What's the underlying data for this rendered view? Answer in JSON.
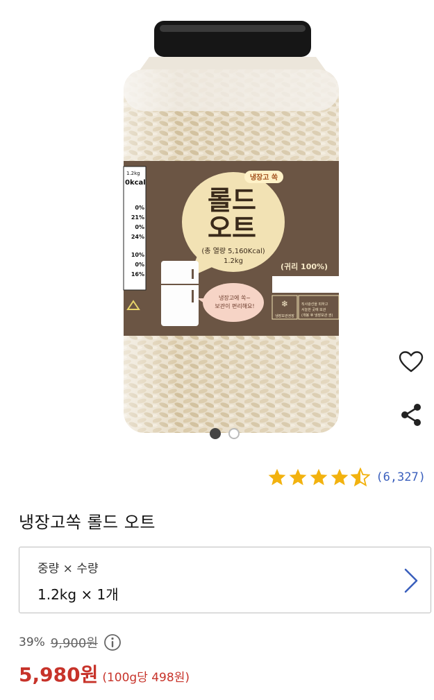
{
  "product": {
    "image": {
      "lid_label": "",
      "badge_small": "냉장고 쏙",
      "brand_line1": "롤드",
      "brand_line2": "오트",
      "calorie_line": "(총 열량 5,160Kcal)",
      "weight_line": "1.2kg",
      "ingredient": "(귀리 100%)",
      "bubble": "냉장고에 쏙~ 보관이 편리해요!",
      "nutrition_header": "1.2kg",
      "nutrition_kcal": "0kcal",
      "nutrition_pcts": [
        "0%",
        "21%",
        "0%",
        "24%",
        "10%",
        "0%",
        "16%"
      ],
      "storage_label": "냉장보관권장",
      "storage_text": "직사광선을 피하고 서늘한 곳에 보관 (개봉 후 냉장보관 권)"
    },
    "carousel": {
      "count": 2,
      "active": 1
    },
    "actions": {
      "favorite_icon": "heart-outline-icon",
      "share_icon": "share-icon"
    },
    "rating": {
      "stars": 4.5,
      "count_text": "(6,327)"
    },
    "title": "냉장고쏙 롤드 오트",
    "option": {
      "label": "중량 × 수량",
      "value": "1.2kg × 1개"
    },
    "price": {
      "discount": "39%",
      "original": "9,900원",
      "sale": "5,980원",
      "unit": "(100g당 498원)"
    },
    "colors": {
      "sale_red": "#c7332a",
      "star_gold": "#f2b20f",
      "link_blue": "#3a5fbd",
      "label_brown": "#6b5544"
    }
  }
}
